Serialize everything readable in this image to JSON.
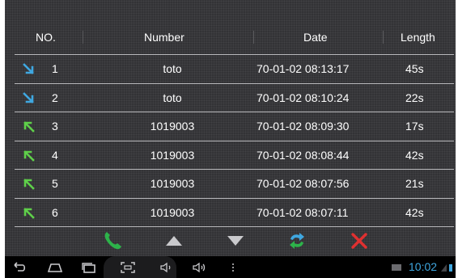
{
  "table": {
    "headers": {
      "no": "NO.",
      "number": "Number",
      "date": "Date",
      "length": "Length"
    },
    "rows": [
      {
        "direction": "incoming",
        "icon": "incoming-call-arrow-icon",
        "no": "1",
        "number": "toto",
        "date": "70-01-02 08:13:17",
        "length": "45s"
      },
      {
        "direction": "incoming",
        "icon": "incoming-call-arrow-icon",
        "no": "2",
        "number": "toto",
        "date": "70-01-02 08:10:24",
        "length": "22s"
      },
      {
        "direction": "outgoing",
        "icon": "outgoing-call-arrow-icon",
        "no": "3",
        "number": "1019003",
        "date": "70-01-02 08:09:30",
        "length": "17s"
      },
      {
        "direction": "outgoing",
        "icon": "outgoing-call-arrow-icon",
        "no": "4",
        "number": "1019003",
        "date": "70-01-02 08:08:44",
        "length": "42s"
      },
      {
        "direction": "outgoing",
        "icon": "outgoing-call-arrow-icon",
        "no": "5",
        "number": "1019003",
        "date": "70-01-02 08:07:56",
        "length": "21s"
      },
      {
        "direction": "outgoing",
        "icon": "outgoing-call-arrow-icon",
        "no": "6",
        "number": "1019003",
        "date": "70-01-02 08:07:11",
        "length": "42s"
      }
    ]
  },
  "toolbar": {
    "buttons": [
      {
        "icon": "phone-icon",
        "color": "#2db34a"
      },
      {
        "icon": "triangle-up-icon",
        "color": "#c9c9cc"
      },
      {
        "icon": "triangle-down-icon",
        "color": "#c9c9cc"
      },
      {
        "icon": "refresh-icon",
        "color": "#3fa7e0"
      },
      {
        "icon": "close-icon",
        "color": "#e03030"
      }
    ]
  },
  "statusbar": {
    "time": "10:02",
    "accent": "#3fa7e0",
    "nav_icons": [
      "back-icon",
      "home-icon",
      "recent-apps-icon",
      "screenshot-icon",
      "volume-down-icon",
      "volume-up-icon",
      "menu-icon"
    ]
  },
  "colors": {
    "incoming": "#3fa7e0",
    "outgoing": "#5fd04a",
    "background": "#333336"
  }
}
